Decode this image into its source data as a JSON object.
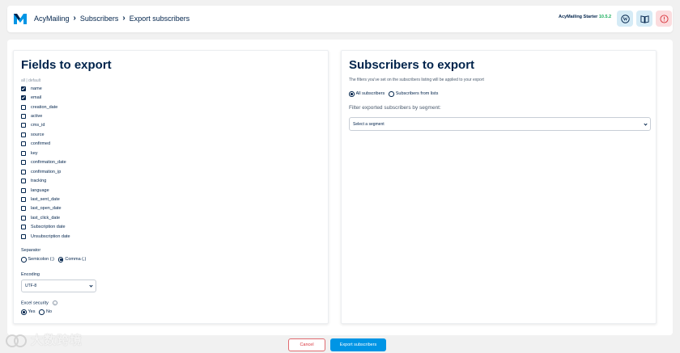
{
  "breadcrumb": [
    "AcyMailing",
    "Subscribers",
    "Export subscribers"
  ],
  "version": {
    "label": "AcyMailing Starter",
    "number": "10.5.2"
  },
  "toolbar": {
    "wordpress_icon": "wordpress-icon",
    "docs_icon": "book-icon",
    "alert_icon": "alert-circle-icon"
  },
  "fields_card": {
    "title": "Fields to export",
    "all_link": "all",
    "divider": "|",
    "default_link": "default",
    "fields": [
      {
        "label": "name",
        "checked": true
      },
      {
        "label": "email",
        "checked": true
      },
      {
        "label": "creation_date",
        "checked": false
      },
      {
        "label": "active",
        "checked": false
      },
      {
        "label": "cms_id",
        "checked": false
      },
      {
        "label": "source",
        "checked": false
      },
      {
        "label": "confirmed",
        "checked": false
      },
      {
        "label": "key",
        "checked": false
      },
      {
        "label": "confirmation_date",
        "checked": false
      },
      {
        "label": "confirmation_ip",
        "checked": false
      },
      {
        "label": "tracking",
        "checked": false
      },
      {
        "label": "language",
        "checked": false
      },
      {
        "label": "last_sent_date",
        "checked": false
      },
      {
        "label": "last_open_date",
        "checked": false
      },
      {
        "label": "last_click_date",
        "checked": false
      },
      {
        "label": "Subscription date",
        "checked": false
      },
      {
        "label": "Unsubscription date",
        "checked": false
      }
    ],
    "separator": {
      "label": "Separator",
      "options": [
        "Semicolon (;)",
        "Comma (,)"
      ],
      "selected": "Comma (,)"
    },
    "encoding": {
      "label": "Encoding",
      "value": "UTF-8"
    },
    "excel": {
      "label": "Excel security",
      "options": [
        "Yes",
        "No"
      ],
      "selected": "Yes"
    }
  },
  "subscribers_card": {
    "title": "Subscribers to export",
    "description": "The filters you've set on the subscribers listing will be applied to your export",
    "options": [
      "All subscribers",
      "Subscribers from lists"
    ],
    "selected": "All subscribers",
    "segment_label": "Filter exported subscribers by segment:",
    "segment_placeholder": "Select a segment"
  },
  "actions": {
    "cancel": "Cancel",
    "export": "Export subscribers"
  },
  "watermark": "大数跨境",
  "colors": {
    "navy": "#00234b",
    "accent": "#0095e5",
    "danger": "#d9363e",
    "version_green": "#16ac5a"
  }
}
